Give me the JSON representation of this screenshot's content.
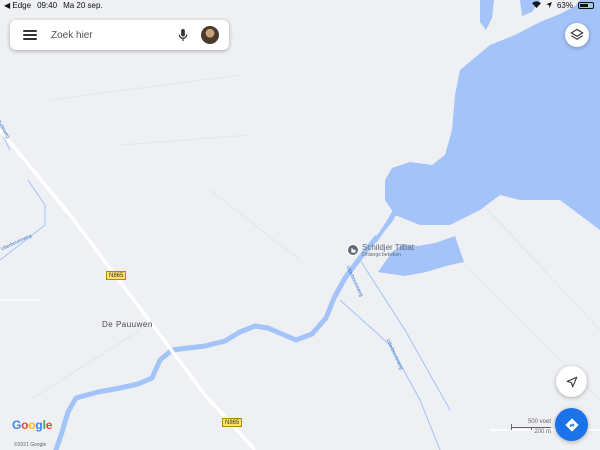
{
  "status_bar": {
    "back_app": "◀ Edge",
    "time": "09:40",
    "date": "Ma 20 sep.",
    "battery_level": 0.63,
    "battery_pct": "63%"
  },
  "search": {
    "placeholder": "Zoek hier"
  },
  "map": {
    "roads": [
      {
        "label": "N865",
        "label_position": "upper-left"
      },
      {
        "label": "N865",
        "label_position": "lower-middle"
      }
    ],
    "place": "De Pauuwen",
    "poi": {
      "name": "Schildjer Tilbat",
      "subtitle": "Onlangs bekeken",
      "icon": "hotel-icon"
    },
    "street_labels": [
      "Uiterbovenweg",
      "Uiterbovenweg",
      "Uiterbovenweg",
      "Oudeweg"
    ],
    "water_color": "#a4c3f8",
    "land_color": "#eef0f3"
  },
  "logo": {
    "text": "Google",
    "letters": [
      "G",
      "o",
      "o",
      "g",
      "l",
      "e"
    ],
    "colors": [
      "#4285f4",
      "#ea4335",
      "#fbbc05",
      "#4285f4",
      "#34a853",
      "#ea4335"
    ]
  },
  "copyright": "©2021 Google",
  "scale": {
    "upper": "500 voet",
    "lower": "200 m"
  },
  "controls": {
    "layers_icon": "layers-icon",
    "locate_icon": "navigation-arrow-icon",
    "directions_icon": "directions-icon"
  }
}
